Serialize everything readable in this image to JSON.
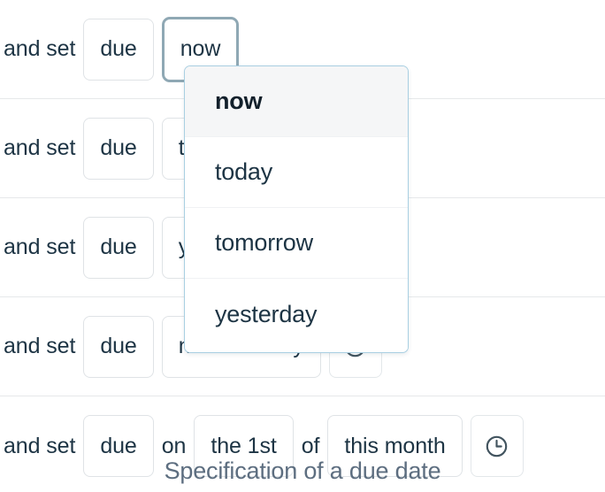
{
  "caption": "Specification of a due date",
  "colors": {
    "text": "#1d3444",
    "caption": "#5d6e80",
    "token_border": "#dfe3e6",
    "focus_border": "#8fa8b4",
    "dropdown_border": "#a9cfe2",
    "dropdown_selected_bg": "#f5f6f7",
    "row_separator": "#e6e8ea",
    "icon_stroke": "#42545f"
  },
  "rows": [
    {
      "lead": "and set",
      "tokens": [
        {
          "label": "due",
          "type": "token",
          "focused": false
        },
        {
          "label": "now",
          "type": "token",
          "focused": true
        }
      ]
    },
    {
      "lead": "and set",
      "tokens": [
        {
          "label": "due",
          "type": "token",
          "focused": false
        },
        {
          "label": "today",
          "type": "token",
          "focused": false
        },
        {
          "label": "clock-icon",
          "type": "icon",
          "focused": false
        }
      ]
    },
    {
      "lead": "and set",
      "tokens": [
        {
          "label": "due",
          "type": "token",
          "focused": false
        },
        {
          "label": "yesterday",
          "type": "token",
          "focused": false
        },
        {
          "label": "clock-icon",
          "type": "icon",
          "focused": false
        }
      ]
    },
    {
      "lead": "and set",
      "tokens": [
        {
          "label": "due",
          "type": "token",
          "focused": false
        },
        {
          "label": "next monday",
          "type": "token",
          "focused": false
        },
        {
          "label": "clock-icon",
          "type": "icon",
          "focused": false
        }
      ]
    },
    {
      "lead": "and set",
      "tokens": [
        {
          "label": "due",
          "type": "token",
          "focused": false
        },
        {
          "label": "on",
          "type": "joiner",
          "focused": false
        },
        {
          "label": "the 1st",
          "type": "token",
          "focused": false
        },
        {
          "label": "of",
          "type": "joiner",
          "focused": false
        },
        {
          "label": "this month",
          "type": "token",
          "focused": false
        },
        {
          "label": "clock-icon",
          "type": "icon",
          "focused": false
        }
      ]
    }
  ],
  "dropdown": {
    "anchor_token": "now",
    "options": [
      {
        "label": "now",
        "selected": true
      },
      {
        "label": "today",
        "selected": false
      },
      {
        "label": "tomorrow",
        "selected": false
      },
      {
        "label": "yesterday",
        "selected": false
      }
    ]
  }
}
